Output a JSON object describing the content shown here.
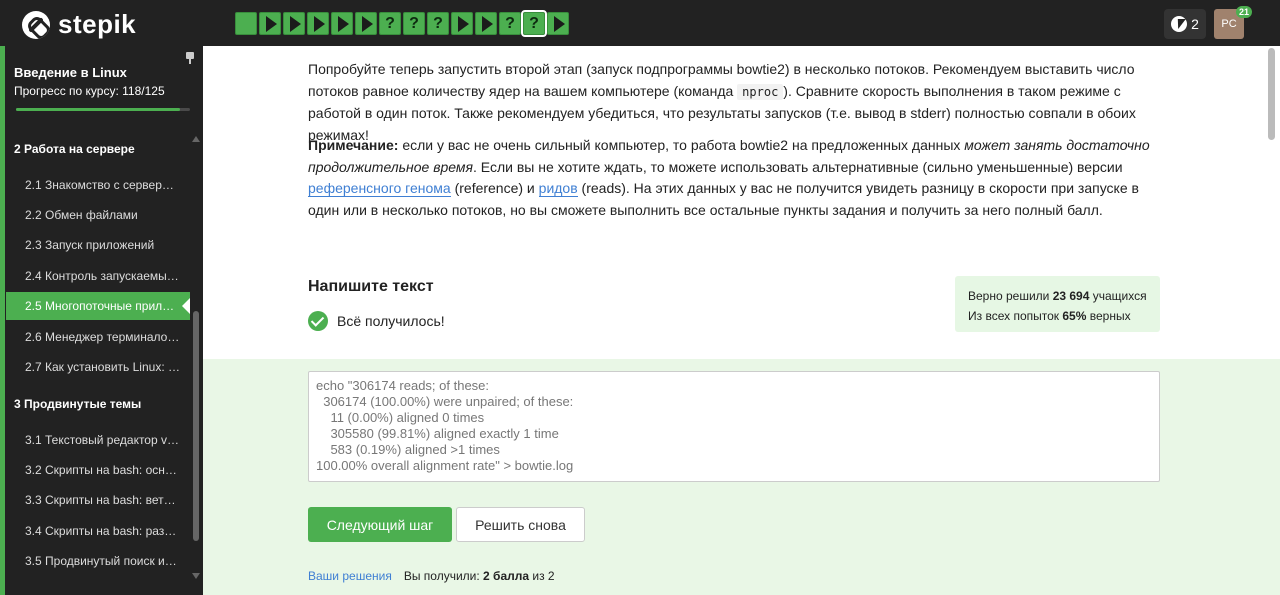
{
  "app": {
    "logo_text": "stepik"
  },
  "steps": [
    {
      "kind": "done"
    },
    {
      "kind": "video"
    },
    {
      "kind": "video"
    },
    {
      "kind": "video"
    },
    {
      "kind": "video"
    },
    {
      "kind": "video"
    },
    {
      "kind": "question",
      "label": "?"
    },
    {
      "kind": "question",
      "label": "?"
    },
    {
      "kind": "question",
      "label": "?"
    },
    {
      "kind": "video"
    },
    {
      "kind": "video"
    },
    {
      "kind": "question",
      "label": "?"
    },
    {
      "kind": "question",
      "label": "?",
      "current": true
    },
    {
      "kind": "video"
    }
  ],
  "header": {
    "energy_count": "2",
    "avatar_initials": "PC",
    "notification_count": "21"
  },
  "sidebar": {
    "course_title": "Введение в Linux",
    "progress_label": "Прогресс по курсу:",
    "progress_value": "118/125",
    "progress_fraction": 0.944,
    "sections": [
      {
        "title": "2  Работа на сервере"
      },
      {
        "title": "3  Продвинутые темы"
      }
    ],
    "lessons": [
      {
        "label": "2.1  Знакомство с сервер…"
      },
      {
        "label": "2.2  Обмен файлами"
      },
      {
        "label": "2.3  Запуск приложений"
      },
      {
        "label": "2.4  Контроль запускаемы…"
      },
      {
        "label": "2.5  Многопоточные прил…"
      },
      {
        "label": "2.6  Менеджер терминало…"
      },
      {
        "label": "2.7  Как установить Linux: …"
      },
      {
        "label": "3.1  Текстовый редактор v…"
      },
      {
        "label": "3.2  Скрипты на bash: осн…"
      },
      {
        "label": "3.3  Скрипты на bash: вет…"
      },
      {
        "label": "3.4  Скрипты на bash: раз…"
      },
      {
        "label": "3.5  Продвинутый поиск и…"
      }
    ]
  },
  "content": {
    "para1_a": "Попробуйте теперь запустить второй этап (запуск подпрограммы bowtie2) в несколько потоков. Рекомендуем выставить число потоков равное количеству ядер на вашем компьютере (команда ",
    "para1_code": "nproc",
    "para1_b": "). Сравните скорость выполнения в таком режиме с работой в один поток. Также рекомендуем убедиться, что результаты запусков (т.е. вывод в stderr) полностью совпали в обоих режимах!",
    "note_label": "Примечание:",
    "note_a": " если у вас не очень сильный компьютер, то работа bowtie2 на предложенных данных ",
    "note_em": "может занять достаточно продолжительное время",
    "note_b": ". Если вы не хотите ждать, то можете использовать альтернативные (сильно уменьшенные) версии ",
    "note_link1": "референсного генома",
    "note_c": " (reference) и ",
    "note_link2": "ридов",
    "note_d": " (reads). На этих данных у вас не получится увидеть разницу в скорости при запуске в один или в несколько потоков, но вы сможете выполнить все остальные пункты задания и получить за него полный балл.",
    "task_title": "Напишите текст",
    "status_text": "Всё получилось!",
    "stats_line1_prefix": "Верно решили ",
    "stats_line1_value": "23 694",
    "stats_line1_suffix": " учащихся",
    "stats_line2_prefix": "Из всех попыток ",
    "stats_line2_value": "65%",
    "stats_line2_suffix": " верных",
    "answer_text": "echo \"306174 reads; of these:\n  306174 (100.00%) were unpaired; of these:\n    11 (0.00%) aligned 0 times\n    305580 (99.81%) aligned exactly 1 time\n    583 (0.19%) aligned >1 times\n100.00% overall alignment rate\" > bowtie.log",
    "next_button": "Следующий шаг",
    "retry_button": "Решить снова",
    "solutions_link": "Ваши решения",
    "score_prefix": "Вы получили: ",
    "score_value": "2 балла",
    "score_suffix": " из 2"
  },
  "colors": {
    "accent": "#4caf50",
    "link": "#3f7fd3",
    "topbar": "#222222",
    "success_bg": "#e9f7e6"
  }
}
